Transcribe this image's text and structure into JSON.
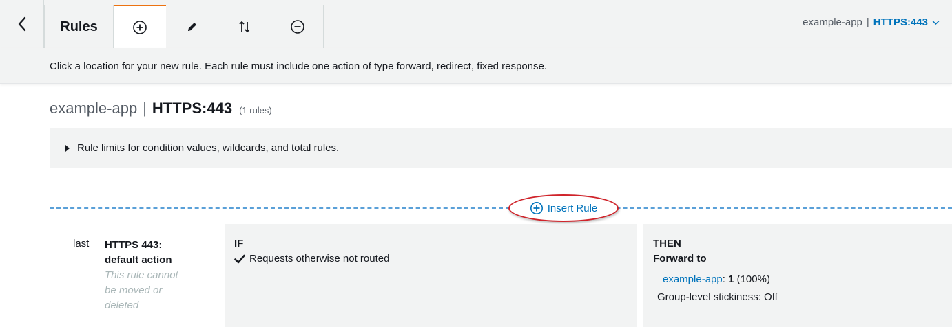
{
  "toolbar": {
    "back_icon": "chevron-left-icon",
    "rules_label": "Rules",
    "add_icon": "plus-circle-icon",
    "edit_icon": "pencil-icon",
    "reorder_icon": "reorder-arrows-icon",
    "remove_icon": "minus-circle-icon",
    "context": {
      "load_balancer": "example-app",
      "separator": "|",
      "listener": "HTTPS:443",
      "caret_icon": "chevron-down-icon"
    }
  },
  "hint": "Click a location for your new rule. Each rule must include one action of type forward, redirect, fixed response.",
  "heading": {
    "load_balancer": "example-app",
    "separator": "|",
    "listener": "HTTPS:443",
    "rule_count": "(1 rules)"
  },
  "limits": {
    "label": "Rule limits for condition values, wildcards, and total rules."
  },
  "insert": {
    "label": "Insert Rule",
    "icon": "plus-circle-icon"
  },
  "rule": {
    "number": "last",
    "name_line1": "HTTPS 443:",
    "name_line2": "default action",
    "note_line1": "This rule cannot",
    "note_line2": "be moved or",
    "note_line3": "deleted",
    "if_label": "IF",
    "condition": "Requests otherwise not routed",
    "then_label": "THEN",
    "action_type": "Forward to",
    "target_group": "example-app",
    "target_weight_prefix": ":",
    "target_weight": "1",
    "target_percent": "(100%)",
    "stickiness": "Group-level stickiness: Off"
  },
  "colors": {
    "accent": "#ec7211",
    "link": "#0073bb",
    "highlight_ring": "#d0232a",
    "panel": "#f2f3f3"
  }
}
